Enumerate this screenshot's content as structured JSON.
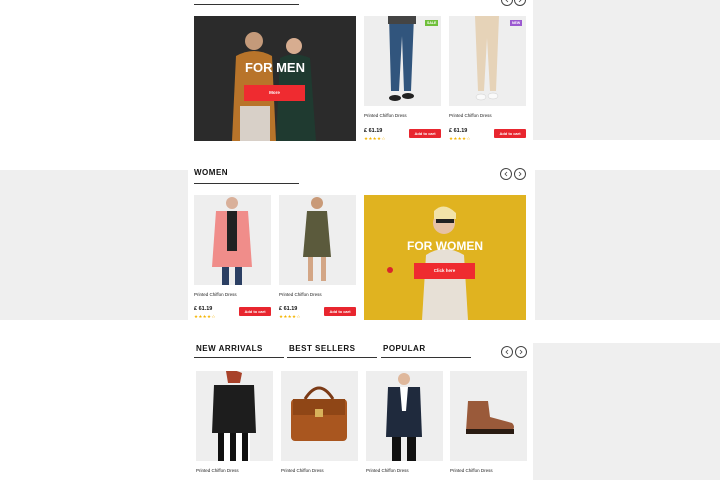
{
  "men_promo": {
    "title": "FOR MEN",
    "button": "More"
  },
  "men_products": [
    {
      "name": "Printed Chiffon Dress",
      "price": "£ 61.19",
      "stars": "★★★★☆",
      "cart": "Add to cart",
      "badge": "SALE",
      "badge_color": "#6fbf3a"
    },
    {
      "name": "Printed Chiffon Dress",
      "price": "£ 61.19",
      "stars": "★★★★☆",
      "cart": "Add to cart",
      "badge": "NEW",
      "badge_color": "#9b59d0"
    }
  ],
  "women": {
    "title": "WOMEN",
    "promo_title": "FOR WOMEN",
    "promo_button": "Click here",
    "products": [
      {
        "name": "Printed Chiffon Dress",
        "price": "£ 61.19",
        "stars": "★★★★☆",
        "cart": "Add to cart"
      },
      {
        "name": "Printed Chiffon Dress",
        "price": "£ 61.19",
        "stars": "★★★★☆",
        "cart": "Add to cart"
      }
    ]
  },
  "bottom": {
    "tabs": [
      "NEW ARRIVALS",
      "BEST SELLERS",
      "POPULAR"
    ],
    "products": [
      {
        "name": "Printed Chiffon Dress"
      },
      {
        "name": "Printed Chiffon Dress"
      },
      {
        "name": "Printed Chiffon Dress"
      },
      {
        "name": "Printed Chiffon Dress"
      }
    ]
  },
  "colors": {
    "accent": "#e8262f",
    "background_gray": "#efefef",
    "star": "#f5b400",
    "men_promo_bg": "#2a2a2a",
    "women_promo_bg": "#e2b521"
  },
  "icons": {
    "prev": "chevron-left-icon",
    "next": "chevron-right-icon"
  }
}
